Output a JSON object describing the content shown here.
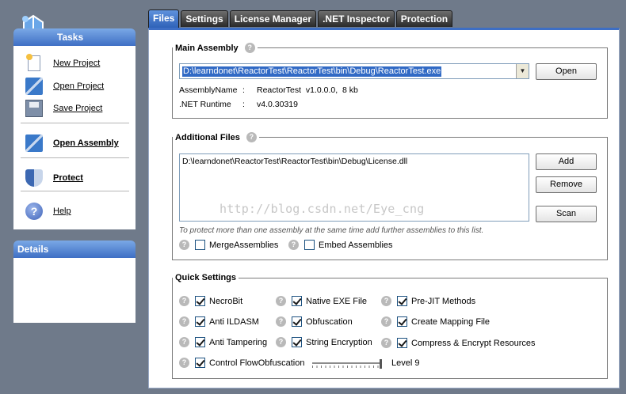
{
  "sidebar": {
    "tasks_title": "Tasks",
    "details_title": "Details",
    "items": [
      {
        "label": "New Project",
        "icon": "new-project-icon"
      },
      {
        "label": "Open Project",
        "icon": "open-project-icon"
      },
      {
        "label": "Save Project",
        "icon": "save-project-icon"
      },
      {
        "label": "Open Assembly",
        "icon": "open-assembly-icon"
      },
      {
        "label": "Protect",
        "icon": "protect-shield-icon"
      },
      {
        "label": "Help",
        "icon": "help-icon"
      }
    ]
  },
  "tabs": [
    "Files",
    "Settings",
    "License Manager",
    ".NET Inspector",
    "Protection"
  ],
  "active_tab": "Files",
  "main_assembly": {
    "title": "Main Assembly",
    "path": "D:\\learndonet\\ReactorTest\\ReactorTest\\bin\\Debug\\ReactorTest.exe",
    "open_label": "Open",
    "assembly_name_label": "AssemblyName",
    "assembly_name_value": "ReactorTest  v1.0.0.0,  8 kb",
    "runtime_label": ".NET Runtime",
    "runtime_value": "v4.0.30319",
    "separator": ":"
  },
  "additional_files": {
    "title": "Additional Files",
    "files": [
      "D:\\learndonet\\ReactorTest\\ReactorTest\\bin\\Debug\\License.dll"
    ],
    "add_label": "Add",
    "remove_label": "Remove",
    "scan_label": "Scan",
    "watermark": "http://blog.csdn.net/Eye_cng",
    "hint": "To protect more than one assembly at the same time add further assemblies to this list.",
    "merge_label": "MergeAssemblies",
    "merge_checked": false,
    "embed_label": "Embed Assemblies",
    "embed_checked": false
  },
  "quick_settings": {
    "title": "Quick Settings",
    "options": [
      {
        "label": "NecroBit",
        "checked": true
      },
      {
        "label": "Native EXE File",
        "checked": true
      },
      {
        "label": "Pre-JIT Methods",
        "checked": true
      },
      {
        "label": "Anti ILDASM",
        "checked": true
      },
      {
        "label": "Obfuscation",
        "checked": true
      },
      {
        "label": "Create Mapping File",
        "checked": true
      },
      {
        "label": "Anti Tampering",
        "checked": true
      },
      {
        "label": "String Encryption",
        "checked": true
      },
      {
        "label": "Compress & Encrypt Resources",
        "checked": true
      }
    ],
    "control_flow_label": "Control FlowObfuscation",
    "control_flow_checked": true,
    "level_label": "Level 9",
    "level_value": 9,
    "level_max": 9
  },
  "colors": {
    "accent": "#3d6ec4",
    "tab_active": "#3f74c8",
    "tab_inactive": "#3a3a3a",
    "selection": "#316ac5"
  }
}
